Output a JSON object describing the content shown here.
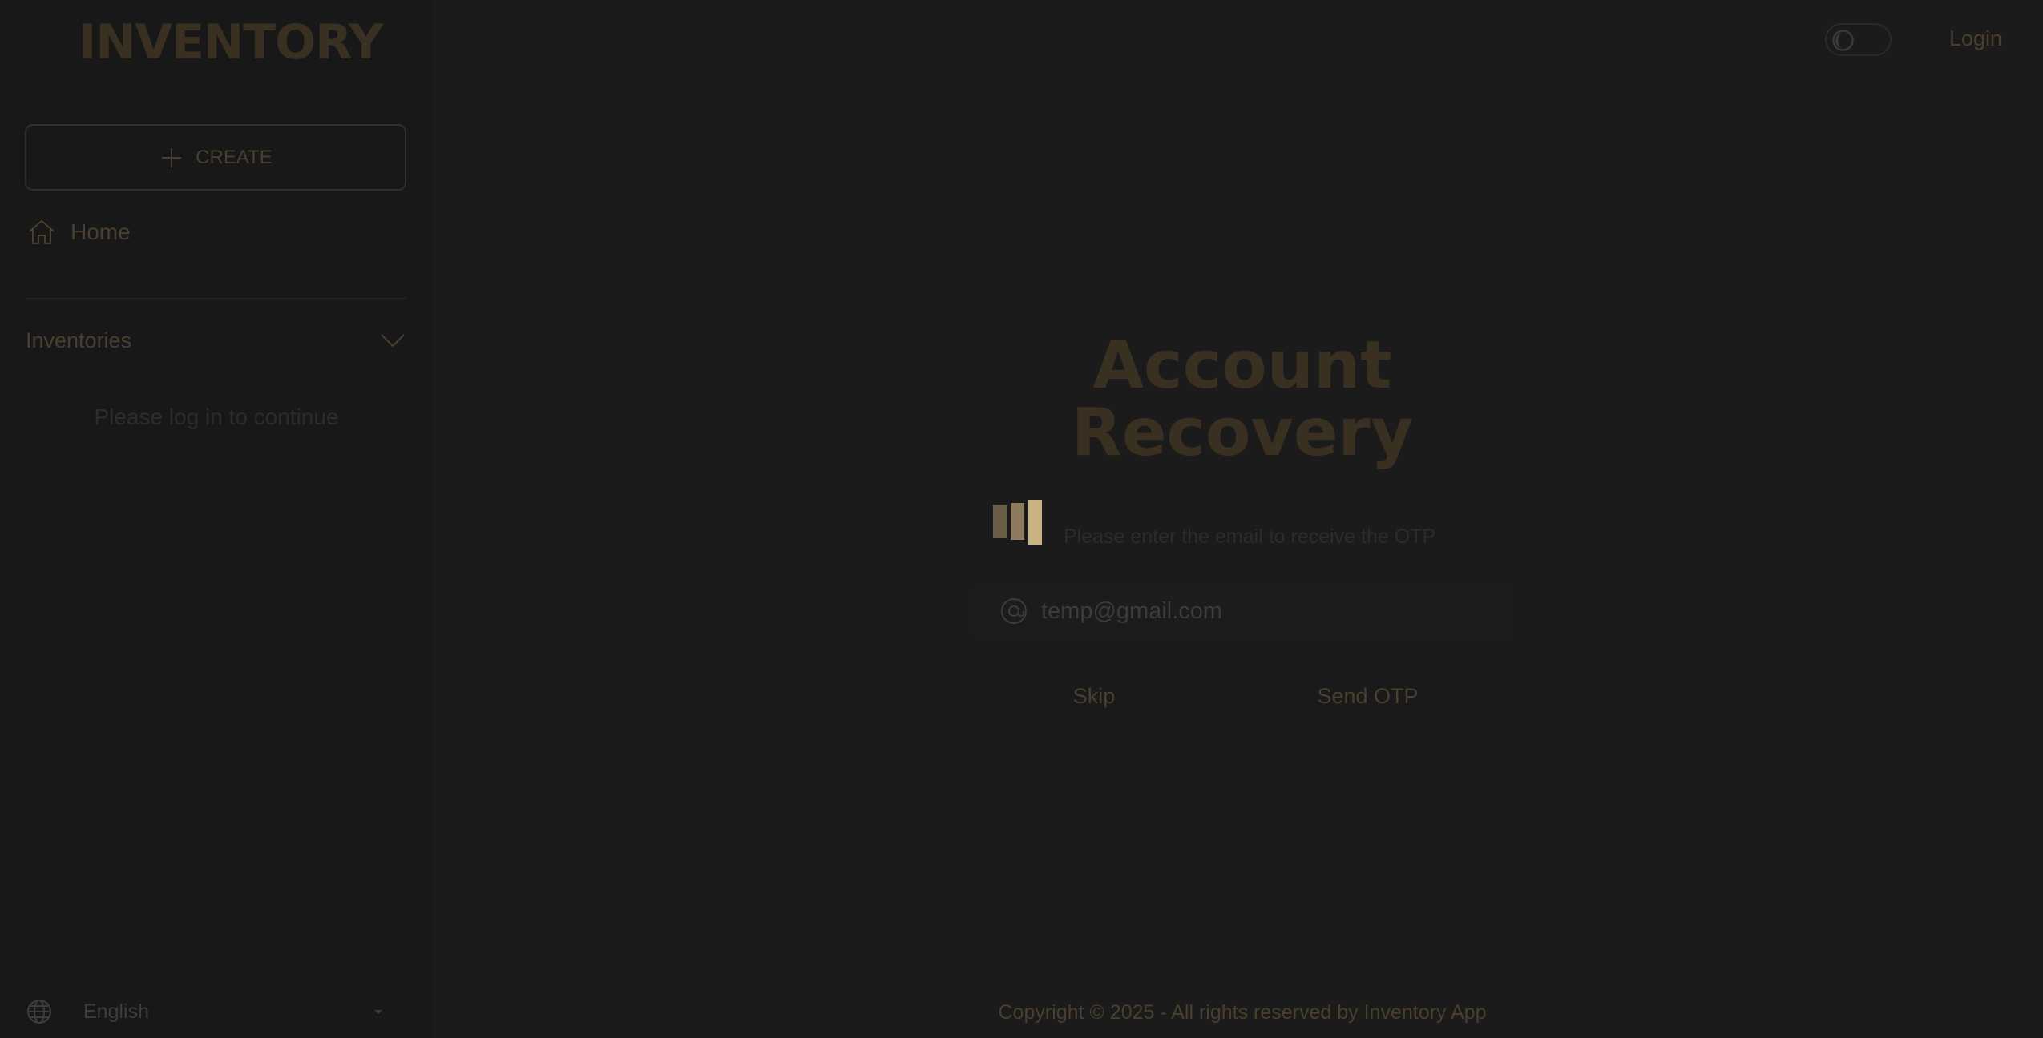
{
  "app": {
    "logo": "INVENTORY"
  },
  "header": {
    "theme_toggle": "dark-mode-toggle",
    "login_label": "Login"
  },
  "sidebar": {
    "create_label": "CREATE",
    "home_label": "Home",
    "inventories_label": "Inventories",
    "login_note": "Please log in to continue",
    "language": "English"
  },
  "recovery": {
    "title_line1": "Account",
    "title_line2": "Recovery",
    "subtitle": "Please enter the email to receive the OTP",
    "email_value": "temp@gmail.com",
    "skip_label": "Skip",
    "send_otp_label": "Send OTP"
  },
  "footer": {
    "copyright": "Copyright © 2025 - All rights reserved by Inventory App"
  },
  "colors": {
    "background": "#1b1b1b",
    "accent_dim": "#4a3f2e",
    "loader_1": "#8a7a60",
    "loader_2": "#a8966f",
    "loader_3": "#d6c08f"
  },
  "icons": {
    "create": "plus-icon",
    "home": "home-icon",
    "inventories": "chevron-down-icon",
    "language": "globe-icon",
    "email": "at-sign-icon",
    "theme": "moon-icon",
    "loader": "loading-bars-icon"
  }
}
